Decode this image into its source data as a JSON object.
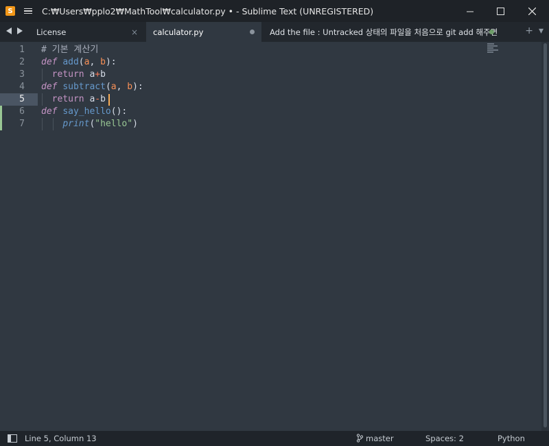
{
  "window": {
    "title": "C:₩Users₩pplo2₩MathTool₩calculator.py • - Sublime Text (UNREGISTERED)",
    "minimize_glyph": "—",
    "close_glyph": "✕"
  },
  "tabs": [
    {
      "label": "License",
      "close": "×",
      "active": false
    },
    {
      "label": "calculator.py",
      "active": true,
      "modified": true
    },
    {
      "label": "Add the file : Untracked 상태의 파일을 처음으로 git add 해주면",
      "active": false,
      "modified": true
    }
  ],
  "tab_tools": {
    "add": "+",
    "menu": "▾"
  },
  "nav": {
    "back": "◀",
    "forward": "▶"
  },
  "editor": {
    "current_line": 5,
    "line_numbers": [
      "1",
      "2",
      "3",
      "4",
      "5",
      "6",
      "7"
    ],
    "lines": [
      [
        {
          "t": "# 기본 계산기",
          "c": "comment"
        }
      ],
      [
        {
          "t": "def",
          "c": "keyword"
        },
        {
          "t": " ",
          "c": "plain"
        },
        {
          "t": "add",
          "c": "func"
        },
        {
          "t": "(",
          "c": "plain"
        },
        {
          "t": "a",
          "c": "param"
        },
        {
          "t": ", ",
          "c": "plain"
        },
        {
          "t": "b",
          "c": "param"
        },
        {
          "t": "):",
          "c": "plain"
        }
      ],
      [
        {
          "t": "  ",
          "c": "plain"
        },
        {
          "t": "return",
          "c": "ctrl"
        },
        {
          "t": " a",
          "c": "plain"
        },
        {
          "t": "+",
          "c": "op"
        },
        {
          "t": "b",
          "c": "plain"
        }
      ],
      [
        {
          "t": "def",
          "c": "keyword"
        },
        {
          "t": " ",
          "c": "plain"
        },
        {
          "t": "subtract",
          "c": "func"
        },
        {
          "t": "(",
          "c": "plain"
        },
        {
          "t": "a",
          "c": "param"
        },
        {
          "t": ", ",
          "c": "plain"
        },
        {
          "t": "b",
          "c": "param"
        },
        {
          "t": "):",
          "c": "plain"
        }
      ],
      [
        {
          "t": "  ",
          "c": "plain"
        },
        {
          "t": "return",
          "c": "ctrl"
        },
        {
          "t": " a",
          "c": "plain"
        },
        {
          "t": "-",
          "c": "op"
        },
        {
          "t": "b",
          "c": "plain"
        }
      ],
      [
        {
          "t": "def",
          "c": "keyword"
        },
        {
          "t": " ",
          "c": "plain"
        },
        {
          "t": "say_hello",
          "c": "func"
        },
        {
          "t": "():",
          "c": "plain"
        }
      ],
      [
        {
          "t": "    ",
          "c": "plain"
        },
        {
          "t": "print",
          "c": "builtin"
        },
        {
          "t": "(",
          "c": "plain"
        },
        {
          "t": "\"hello\"",
          "c": "string"
        },
        {
          "t": ")",
          "c": "plain"
        }
      ]
    ]
  },
  "status": {
    "position": "Line 5, Column 13",
    "branch": "master",
    "indent": "Spaces: 2",
    "syntax": "Python"
  },
  "colors": {
    "accent_caret": "#f9ae58",
    "diff_added": "#99c794",
    "background": "#303841"
  }
}
